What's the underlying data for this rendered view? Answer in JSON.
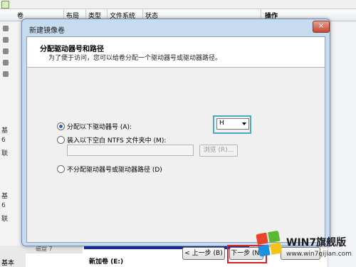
{
  "background": {
    "columns": [
      "卷",
      "布局",
      "类型",
      "文件系统",
      "状态",
      "操作"
    ],
    "left_labels": [
      "基",
      "6",
      "联",
      "基",
      "6",
      "联"
    ],
    "disk_label": "基本",
    "disk7_label": "磁盘 7",
    "volume_label": "新加卷  (E:)"
  },
  "dialog": {
    "title": "新建镜像卷",
    "close_icon": "×",
    "header_title": "分配驱动器号和路径",
    "header_subtitle": "为了便于访问，您可以给卷分配一个驱动器号或驱动器路径。",
    "options": [
      {
        "label": "分配以下驱动器号 (A):",
        "selected": true
      },
      {
        "label": "装入以下空白 NTFS 文件夹中 (M):",
        "selected": false
      },
      {
        "label": "不分配驱动器号或驱动器路径 (D)",
        "selected": false
      }
    ],
    "drive_letter": "H",
    "folder_path": "",
    "browse_label": "浏览 (R)...",
    "back_label": "< 上一步 (B)",
    "next_label": "下一步 (N) >",
    "cancel_label": ""
  },
  "watermark": {
    "brand": "WIN7旗舰版",
    "url": "www.win7qijian.com",
    "colors": {
      "red": "#e8452b",
      "green": "#5bb831",
      "blue": "#1f8fe0",
      "yellow": "#f5c21a"
    }
  }
}
